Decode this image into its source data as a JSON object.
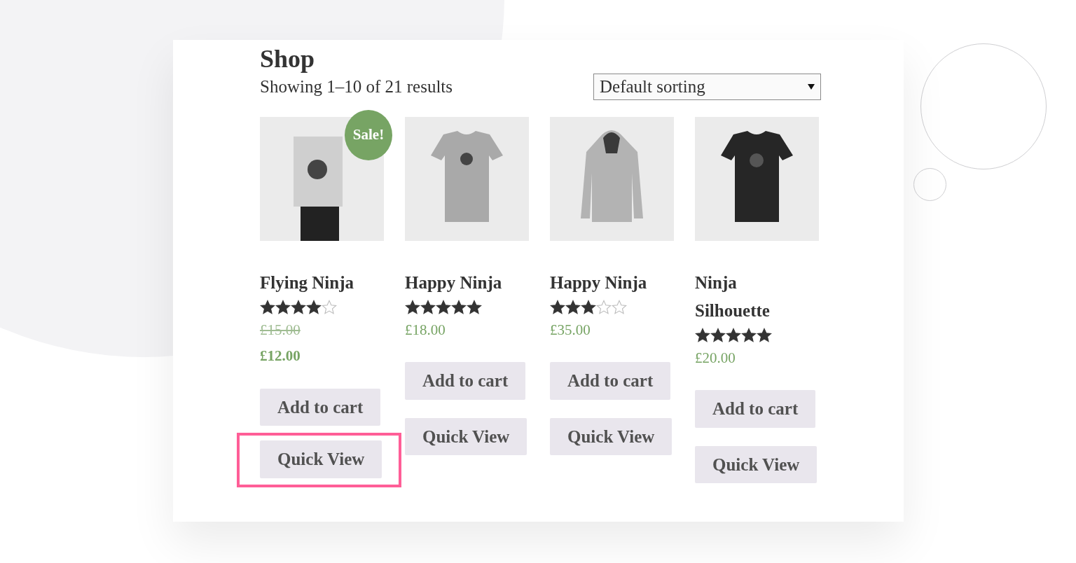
{
  "page": {
    "title": "Shop",
    "result_count": "Showing 1–10 of 21 results"
  },
  "sorting": {
    "value": "Default sorting"
  },
  "products": [
    {
      "name": "Flying Ninja",
      "on_sale": true,
      "sale_badge": "Sale!",
      "stars": 4,
      "old_price": "£15.00",
      "price": "£12.00",
      "buttons": [
        "Add to cart",
        "Quick View"
      ],
      "highlighted": true
    },
    {
      "name": "Happy Ninja",
      "on_sale": false,
      "stars": 5,
      "price": "£18.00",
      "buttons": [
        "Add to cart",
        "Quick View"
      ],
      "highlighted": false
    },
    {
      "name": "Happy Ninja",
      "on_sale": false,
      "stars": 3,
      "price": "£35.00",
      "buttons": [
        "Add to cart",
        "Quick View"
      ],
      "highlighted": false
    },
    {
      "name": "Ninja Silhouette",
      "on_sale": false,
      "stars": 5,
      "price": "£20.00",
      "buttons": [
        "Add to cart",
        "Quick View"
      ],
      "highlighted": false
    }
  ]
}
